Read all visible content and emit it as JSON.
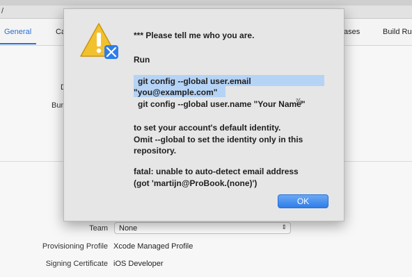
{
  "window": {
    "toolbar_fragment": "/"
  },
  "tabs": [
    {
      "label": "General"
    },
    {
      "label": "Ca"
    },
    {
      "label": "ases"
    },
    {
      "label": "Build Ru"
    }
  ],
  "background": {
    "fragment_d": "D",
    "fragment_bun": "Bun"
  },
  "signing": {
    "team_label": "Team",
    "team_value": "None",
    "provisioning_label": "Provisioning Profile",
    "provisioning_value": "Xcode Managed Profile",
    "certificate_label": "Signing Certificate",
    "certificate_value": "iOS Developer"
  },
  "dialog": {
    "title": "*** Please tell me who you are.",
    "run_label": "Run",
    "cmd_email_1": "git config --global user.email",
    "cmd_email_2": "\"you@example.com\"",
    "cmd_name": "git config --global user.name \"Your Name\"",
    "desc_1": "to set your account's default identity.",
    "desc_2": "Omit --global to set the identity only in this",
    "desc_3": "repository.",
    "error_1": "fatal: unable to auto-detect email address",
    "error_2": "(got 'martijn@ProBook.(none)')",
    "ok_label": "OK",
    "icon": "warning-icon"
  }
}
